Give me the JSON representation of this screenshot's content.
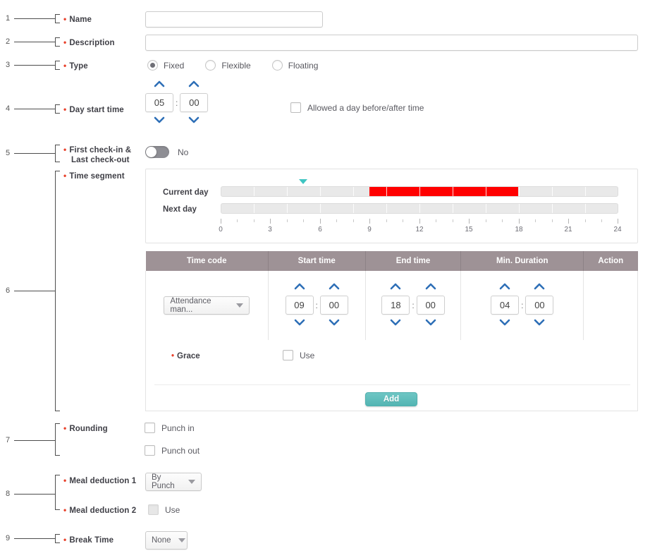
{
  "form": {
    "rows": [
      {
        "num": "1",
        "label": "Name",
        "required": true
      },
      {
        "num": "2",
        "label": "Description",
        "required": true
      },
      {
        "num": "3",
        "label": "Type",
        "required": true
      },
      {
        "num": "4",
        "label": "Day start time",
        "required": true
      },
      {
        "num": "5",
        "label_line1": "First check-in &",
        "label_line2": "Last check-out",
        "required": true
      },
      {
        "num": "6",
        "label": "Time segment",
        "required": true
      },
      {
        "num": "7",
        "label": "Rounding",
        "required": true
      },
      {
        "num": "8",
        "label": "Meal deduction 1",
        "required": true
      },
      {
        "num": "9",
        "label": "Break Time",
        "required": true
      }
    ],
    "name": {
      "value": "",
      "placeholder": ""
    },
    "description": {
      "value": "",
      "placeholder": ""
    },
    "type": {
      "options": [
        "Fixed",
        "Flexible",
        "Floating"
      ],
      "selected": "Fixed"
    },
    "day_start_time": {
      "hours": "05",
      "minutes": "00",
      "separator": ":",
      "allowed_checkbox": {
        "label": "Allowed a day before/after time",
        "checked": false
      }
    },
    "first_last_check": {
      "toggle_state": "No",
      "on": false
    },
    "rounding": {
      "punch_in": {
        "label": "Punch in",
        "checked": false
      },
      "punch_out": {
        "label": "Punch out",
        "checked": false
      }
    },
    "meal_deduction_1": {
      "value": "By Punch"
    },
    "meal_deduction_2": {
      "label": "Meal deduction 2",
      "use_label": "Use",
      "checked": false,
      "disabled": true
    },
    "break_time": {
      "value": "None"
    }
  },
  "time_segment": {
    "timeline": {
      "rows": [
        {
          "label": "Current day",
          "segments": [
            {
              "start": 9,
              "end": 18,
              "color": "#ff0000"
            }
          ]
        },
        {
          "label": "Next day",
          "segments": []
        }
      ],
      "axis": {
        "min": 0,
        "max": 24,
        "major_ticks": [
          0,
          3,
          6,
          9,
          12,
          15,
          18,
          21,
          24
        ]
      },
      "day_start_marker": {
        "hour": 5,
        "color": "#3fc5c2"
      }
    },
    "table": {
      "columns": [
        "Time code",
        "Start time",
        "End time",
        "Min. Duration",
        "Action"
      ],
      "rows": [
        {
          "time_code": "Attendance man...",
          "start_time": {
            "hours": "09",
            "minutes": "00"
          },
          "end_time": {
            "hours": "18",
            "minutes": "00"
          },
          "min_duration": {
            "hours": "04",
            "minutes": "00"
          },
          "action": ""
        }
      ]
    },
    "grace": {
      "label": "Grace",
      "use_label": "Use",
      "checked": false
    },
    "add_button": "Add"
  },
  "colors": {
    "required_marker": "#e8402a",
    "table_header_bg": "#9e9296",
    "segment_red": "#ff0000",
    "marker_teal": "#3fc5c2",
    "add_button": "#53b5b3",
    "chevron_blue": "#2e6fb7"
  }
}
